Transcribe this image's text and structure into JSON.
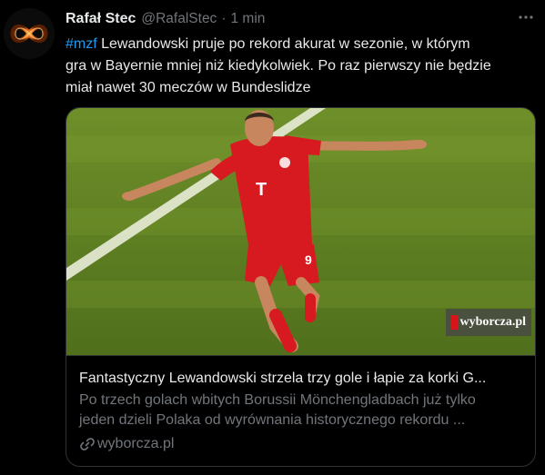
{
  "author": {
    "name": "Rafał Stec",
    "handle": "@RafalStec",
    "separator": "·",
    "time": "1 min"
  },
  "tweet": {
    "hashtag": "#mzf",
    "line1_rest": " Lewandowski pruje po rekord akurat w sezonie, w którym",
    "line2": "gra w Bayernie mniej niż kiedykolwiek. Po raz pierwszy nie będzie",
    "line3": "miał nawet 30 meczów w Bundeslidze"
  },
  "card": {
    "title": "Fantastyczny Lewandowski strzela trzy gole i łapie za korki G...",
    "description_line1": "Po trzech golach wbitych Borussii Mönchengladbach już tylko",
    "description_line2": "jeden dzieli Polaka od wyrównania historycznego rekordu ...",
    "domain": "wyborcza.pl",
    "watermark": "wyborcza.pl",
    "image_description": "football player in red kit celebrating on pitch"
  },
  "icons": {
    "avatar": "infinity-logo",
    "more": "more-dots-icon",
    "link": "link-icon"
  },
  "colors": {
    "background": "#000000",
    "text": "#e7e9ea",
    "muted": "#71767b",
    "accent": "#1d9bf0",
    "border": "#2f3336"
  }
}
